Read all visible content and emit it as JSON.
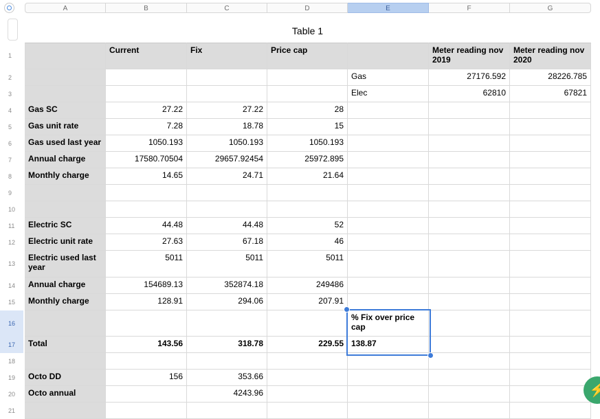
{
  "table_title": "Table 1",
  "columns": [
    "A",
    "B",
    "C",
    "D",
    "E",
    "F",
    "G"
  ],
  "selected_column": "E",
  "selected_rows": [
    "16",
    "17"
  ],
  "rows": [
    {
      "num": "1",
      "cells": [
        "",
        "Current",
        "Fix",
        "Price cap",
        "",
        "Meter reading nov 2019",
        "Meter reading nov 2020"
      ]
    },
    {
      "num": "2",
      "cells": [
        "",
        "",
        "",
        "",
        "Gas",
        "27176.592",
        "28226.785"
      ]
    },
    {
      "num": "3",
      "cells": [
        "",
        "",
        "",
        "",
        "Elec",
        "62810",
        "67821"
      ]
    },
    {
      "num": "4",
      "cells": [
        "Gas SC",
        "27.22",
        "27.22",
        "28",
        "",
        "",
        ""
      ]
    },
    {
      "num": "5",
      "cells": [
        "Gas unit rate",
        "7.28",
        "18.78",
        "15",
        "",
        "",
        ""
      ]
    },
    {
      "num": "6",
      "cells": [
        "Gas used last year",
        "1050.193",
        "1050.193",
        "1050.193",
        "",
        "",
        ""
      ]
    },
    {
      "num": "7",
      "cells": [
        "Annual charge",
        "17580.70504",
        "29657.92454",
        "25972.895",
        "",
        "",
        ""
      ]
    },
    {
      "num": "8",
      "cells": [
        "Monthly charge",
        "14.65",
        "24.71",
        "21.64",
        "",
        "",
        ""
      ]
    },
    {
      "num": "9",
      "cells": [
        "",
        "",
        "",
        "",
        "",
        "",
        ""
      ]
    },
    {
      "num": "10",
      "cells": [
        "",
        "",
        "",
        "",
        "",
        "",
        ""
      ]
    },
    {
      "num": "11",
      "cells": [
        "Electric SC",
        "44.48",
        "44.48",
        "52",
        "",
        "",
        ""
      ]
    },
    {
      "num": "12",
      "cells": [
        "Electric unit rate",
        "27.63",
        "67.18",
        "46",
        "",
        "",
        ""
      ]
    },
    {
      "num": "13",
      "cells": [
        "Electric used last year",
        "5011",
        "5011",
        "5011",
        "",
        "",
        ""
      ]
    },
    {
      "num": "14",
      "cells": [
        "Annual charge",
        "154689.13",
        "352874.18",
        "249486",
        "",
        "",
        ""
      ]
    },
    {
      "num": "15",
      "cells": [
        "Monthly charge",
        "128.91",
        "294.06",
        "207.91",
        "",
        "",
        ""
      ]
    },
    {
      "num": "16",
      "cells": [
        "",
        "",
        "",
        "",
        "% Fix over price cap",
        "",
        ""
      ]
    },
    {
      "num": "17",
      "cells": [
        "Total",
        "143.56",
        "318.78",
        "229.55",
        "138.87",
        "",
        ""
      ]
    },
    {
      "num": "18",
      "cells": [
        "",
        "",
        "",
        "",
        "",
        "",
        ""
      ]
    },
    {
      "num": "19",
      "cells": [
        "Octo DD",
        "156",
        "353.66",
        "",
        "",
        "",
        ""
      ]
    },
    {
      "num": "20",
      "cells": [
        "Octo annual",
        "",
        "4243.96",
        "",
        "",
        "",
        ""
      ]
    },
    {
      "num": "21",
      "cells": [
        "",
        "",
        "",
        "",
        "",
        "",
        ""
      ]
    }
  ]
}
